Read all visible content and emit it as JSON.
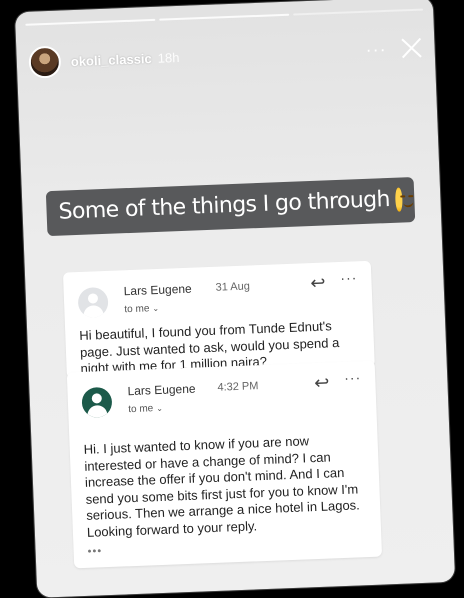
{
  "story": {
    "username": "okoli_classic",
    "timestamp": "18h",
    "more_glyph": "···",
    "caption": "Some of the things I go through",
    "caption_emoji": "smirk-face-emoji"
  },
  "emails": [
    {
      "sender": "Lars Eugene",
      "date": "31 Aug",
      "recipient": "to me",
      "reply_glyph": "↩",
      "more_glyph": "···",
      "body": "Hi beautiful, I found you from Tunde Ednut's page. Just wanted to ask, would you spend a night with me for 1 million naira?"
    },
    {
      "sender": "Lars Eugene",
      "date": "4:32 PM",
      "recipient": "to me",
      "reply_glyph": "↩",
      "more_glyph": "···",
      "body": "Hi. I just wanted to know if you are now interested or have a change of mind? I can increase the offer if you don't mind. And I can send you some bits first just for you to know I'm serious. Then we arrange a nice hotel in Lagos. Looking forward to your reply.",
      "collapsed_glyph": "•••"
    }
  ],
  "colors": {
    "caption_bg": "#58595b",
    "sender2_avatar": "#1c5a4a"
  }
}
